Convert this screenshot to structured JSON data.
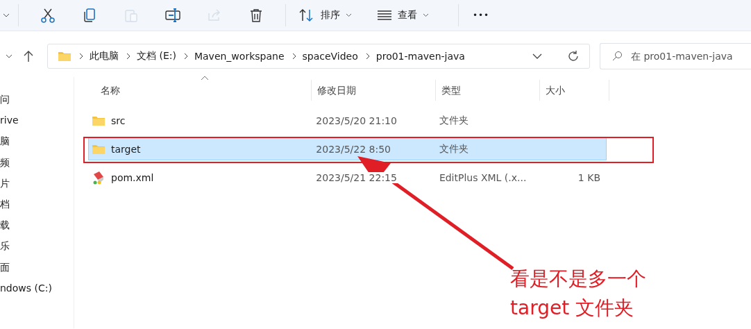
{
  "toolbar": {
    "buttons": [
      {
        "kind": "cut",
        "disabled": false
      },
      {
        "kind": "copy",
        "disabled": false
      },
      {
        "kind": "paste",
        "disabled": true
      },
      {
        "kind": "rename",
        "disabled": false
      },
      {
        "kind": "share",
        "disabled": true
      },
      {
        "kind": "delete",
        "disabled": false
      }
    ],
    "sort": {
      "label": "排序"
    },
    "view": {
      "label": "查看"
    },
    "more": "•••"
  },
  "address_bar": {
    "path": [
      "此电脑",
      "文档 (E:)",
      "Maven_workspane",
      "spaceVideo",
      "pro01-maven-java"
    ]
  },
  "search": {
    "placeholder": "在 pro01-maven-java"
  },
  "sidebar": {
    "items": [
      "问",
      "rive",
      "脑",
      "频",
      "片",
      "档",
      "载",
      "乐",
      "面",
      "ndows (C:)"
    ]
  },
  "table": {
    "columns": [
      "名称",
      "修改日期",
      "类型",
      "大小"
    ],
    "rows": [
      {
        "kind": "folder",
        "name": "src",
        "date": "2023/5/20 21:10",
        "type": "文件夹",
        "size": "",
        "selected": false
      },
      {
        "kind": "folder",
        "name": "target",
        "date": "2023/5/22 8:50",
        "type": "文件夹",
        "size": "",
        "selected": true
      },
      {
        "kind": "xml",
        "name": "pom.xml",
        "date": "2023/5/21 22:15",
        "type": "EditPlus XML (.x...",
        "size": "1 KB",
        "selected": false
      }
    ]
  },
  "annotation": {
    "lines": [
      "看是不是多一个",
      "target 文件夹"
    ]
  }
}
